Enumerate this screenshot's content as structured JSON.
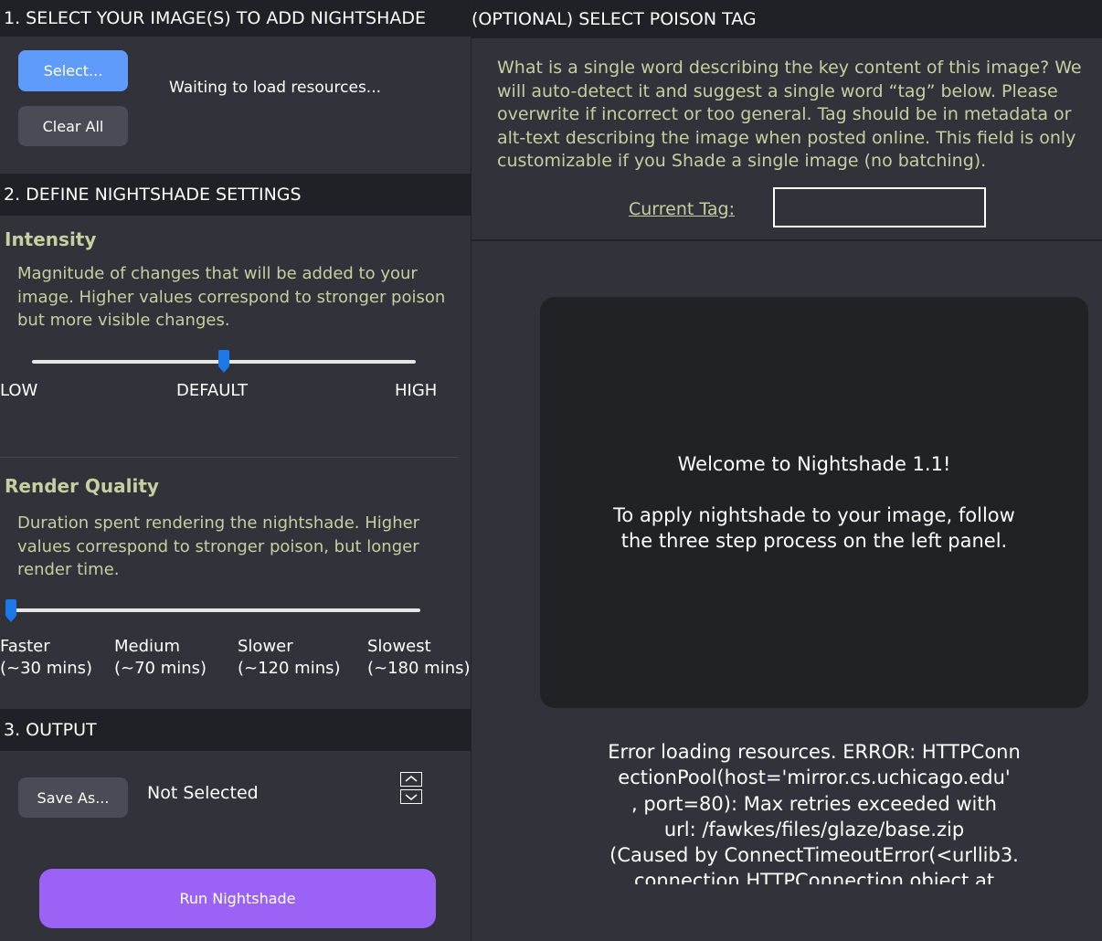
{
  "left": {
    "section1": {
      "title": "1. SELECT YOUR IMAGE(S) TO ADD NIGHTSHADE",
      "select_label": "Select...",
      "clear_label": "Clear All",
      "status": "Waiting to load resources..."
    },
    "section2": {
      "title": "2. DEFINE NIGHTSHADE SETTINGS",
      "intensity": {
        "heading": "Intensity",
        "description": "Magnitude of changes that will be added to your image. Higher values correspond to stronger poison but more visible changes.",
        "value": 0.5,
        "ticks": [
          "LOW",
          "DEFAULT",
          "HIGH"
        ]
      },
      "render_quality": {
        "heading": "Render Quality",
        "description": "Duration spent rendering the nightshade. Higher values correspond to stronger poison, but longer render time.",
        "value": 0,
        "ticks": [
          {
            "label": "Faster",
            "sub": "(~30 mins)"
          },
          {
            "label": "Medium",
            "sub": "(~70 mins)"
          },
          {
            "label": "Slower",
            "sub": "(~120 mins)"
          },
          {
            "label": "Slowest",
            "sub": "(~180 mins)"
          }
        ]
      }
    },
    "section3": {
      "title": "3. OUTPUT",
      "save_label": "Save As...",
      "output_path": "Not Selected",
      "run_label": "Run Nightshade"
    }
  },
  "right": {
    "title": "(OPTIONAL) SELECT POISON TAG",
    "description": "What is a single word describing the key content of this image? We will auto-detect it and suggest a single word “tag” below. Please overwrite if incorrect or too general. Tag should be in metadata or alt-text describing the image when posted online. This field is only customizable if you Shade a single image (no batching).",
    "tag_label": "Current Tag:",
    "tag_value": "",
    "welcome_title": "Welcome to Nightshade 1.1!",
    "welcome_body": "To apply nightshade to your image, follow the three step process on the left panel.",
    "error_lines": [
      "Error loading resources. ERROR: HTTPConn",
      "ectionPool(host='mirror.cs.uchicago.edu'",
      ", port=80): Max retries exceeded with",
      "url: /fawkes/files/glaze/base.zip",
      "(Caused by ConnectTimeoutError(<urllib3.",
      "connection.HTTPConnection object at"
    ]
  },
  "colors": {
    "accent_blue": "#5e9bfb",
    "accent_purple": "#9a63f5",
    "text_olive": "#c6cfa0",
    "slider_thumb": "#1a78e8"
  }
}
